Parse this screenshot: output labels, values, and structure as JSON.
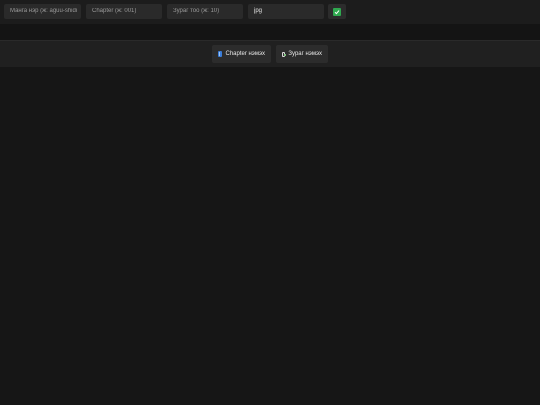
{
  "toolbar": {
    "manga_placeholder": "Манга нэр (ж: aguu-shidi",
    "chapter_placeholder": "Chapter (ж: 001)",
    "count_placeholder": "Зураг тоо (ж: 10)",
    "extension_value": "jpg",
    "confirm_icon": "check-mark-icon"
  },
  "navigation": {
    "chapter_button_label": "Chapter нэмэх",
    "chapter_button_icon": "book-icon",
    "image_button_label": "Зураг нэмэх",
    "image_button_icon": "image-icon"
  },
  "colors": {
    "background": "#161616",
    "field": "#2a2a2a",
    "confirm_accent": "#2fa84f",
    "book_accent": "#3b7dd8"
  }
}
